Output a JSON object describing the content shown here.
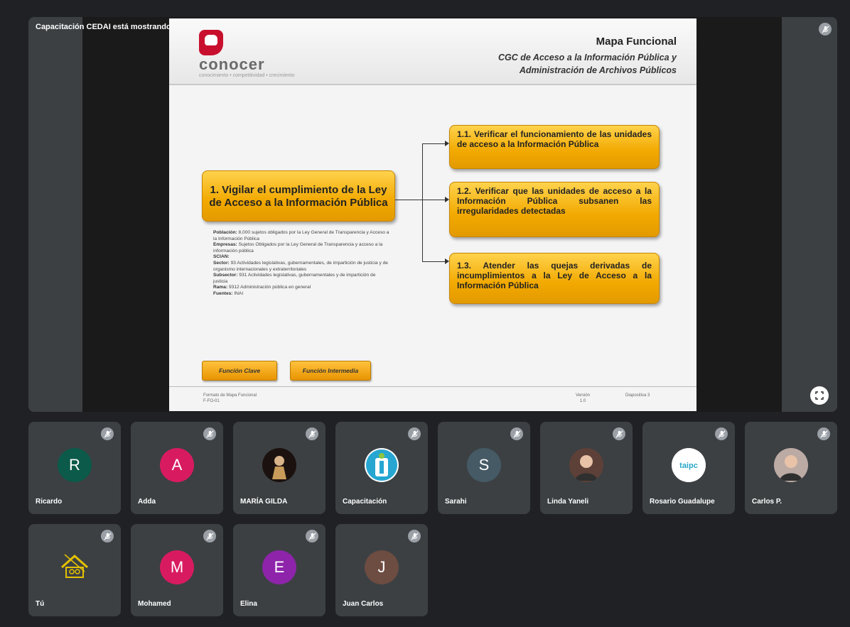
{
  "meeting": {
    "presenting_label": "Capacitación CEDAI está mostrando",
    "mic_icon": "mic-off-icon",
    "fullscreen_icon": "fullscreen-icon"
  },
  "slide": {
    "logo_text": "conocer",
    "logo_tagline": "conocimiento • competitividad • crecimiento",
    "title": "Mapa Funcional",
    "subtitle_line1": "CGC de Acceso a la Información Pública y",
    "subtitle_line2": "Administración de Archivos Públicos",
    "main_function": "1. Vigilar el cumplimiento de la Ley de Acceso a la Información Pública",
    "sub_functions": [
      "1.1. Verificar el funcionamiento de las unidades de acceso a la Información Pública",
      "1.2. Verificar que las unidades de acceso a la Información Pública subsanen las irregularidades detectadas",
      "1.3. Atender las quejas derivadas de incumplimientos a la Ley de Acceso a la Información Pública"
    ],
    "info": {
      "poblacion_label": "Población:",
      "poblacion": "8,000 sujetos obligados por la Ley General de Transparencia y Acceso a la Información Pública",
      "empresas_label": "Empresas:",
      "empresas": "Sujetos Obligados por la Ley General de Transparencia y acceso a la información pública",
      "scian_label": "SCIAN:",
      "sector_label": "Sector:",
      "sector": "93 Actividades legislativas, gubernamentales, de impartición de justicia y de organismo internacionales y extraterritoriales",
      "subsector_label": "Subsector:",
      "subsector": "931 Actividades legislativas, gubernamentales y de impartición de justicia",
      "rama_label": "Rama:",
      "rama": "9312 Administración pública en general",
      "fuentes_label": "Fuentes:",
      "fuentes": "INAI"
    },
    "legend_key": "Función Clave",
    "legend_intermediate": "Función Intermedia",
    "footer_left_1": "Formato de Mapa Funcional",
    "footer_left_2": "F-FO-01",
    "footer_version_label": "Versión",
    "footer_version": "1.0",
    "footer_slide": "Diapositiva 3"
  },
  "participants": [
    {
      "name": "Ricardo",
      "initial": "R",
      "color": "#0b5a4a",
      "type": "initial"
    },
    {
      "name": "Adda",
      "initial": "A",
      "color": "#d81b60",
      "type": "initial"
    },
    {
      "name": "MARÍA GILDA",
      "initial": "",
      "color": "#2b1a14",
      "type": "photo"
    },
    {
      "name": "Capacitación",
      "initial": "",
      "color": "#ffffff",
      "type": "logo-i"
    },
    {
      "name": "Sarahi",
      "initial": "S",
      "color": "#455a64",
      "type": "initial"
    },
    {
      "name": "Linda Yaneli",
      "initial": "",
      "color": "#5d4037",
      "type": "photo-person"
    },
    {
      "name": "Rosario Guadalupe",
      "initial": "",
      "color": "#ffffff",
      "type": "logo-text"
    },
    {
      "name": "Carlos P.",
      "initial": "",
      "color": "#bcaaa4",
      "type": "photo-person"
    },
    {
      "name": "Tú",
      "initial": "",
      "color": "#3c4043",
      "type": "logo-house"
    },
    {
      "name": "Mohamed",
      "initial": "M",
      "color": "#d81b60",
      "type": "initial"
    },
    {
      "name": "Elina",
      "initial": "E",
      "color": "#8e24aa",
      "type": "initial"
    },
    {
      "name": "Juan Carlos",
      "initial": "J",
      "color": "#6d4c41",
      "type": "initial"
    }
  ],
  "logo_label": "taipc"
}
